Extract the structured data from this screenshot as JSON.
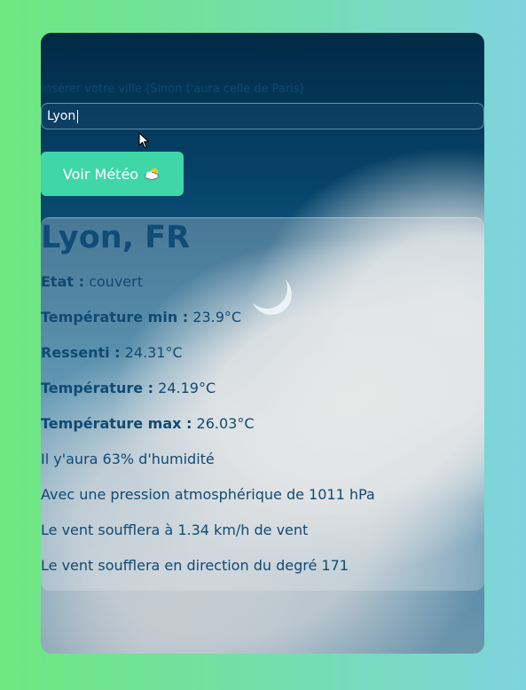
{
  "search": {
    "label": "Insérer votre ville (Sinon t'aura celle de Paris)",
    "value": "Lyon"
  },
  "button": {
    "label": "Voir Météo",
    "icon": "cloud-sun-icon"
  },
  "weather": {
    "city": "Lyon, FR",
    "rows": [
      {
        "label": "Etat :",
        "value": "couvert"
      },
      {
        "label": "Température min :",
        "value": "23.9°C"
      },
      {
        "label": "Ressenti :",
        "value": "24.31°C"
      },
      {
        "label": "Température :",
        "value": "24.19°C"
      },
      {
        "label": "Température max :",
        "value": "26.03°C"
      }
    ],
    "humidity": "Il y'aura 63% d'humidité",
    "pressure": "Avec une pression atmosphérique de 1011 hPa",
    "wind_speed": "Le vent soufflera à 1.34 km/h de vent",
    "wind_direction": "Le vent soufflera en direction du degré 171"
  },
  "colors": {
    "page_gradient_left": "#6ee87f",
    "page_gradient_right": "#7fd3de",
    "button": "#3fd6a8",
    "text": "#0f4a73"
  }
}
